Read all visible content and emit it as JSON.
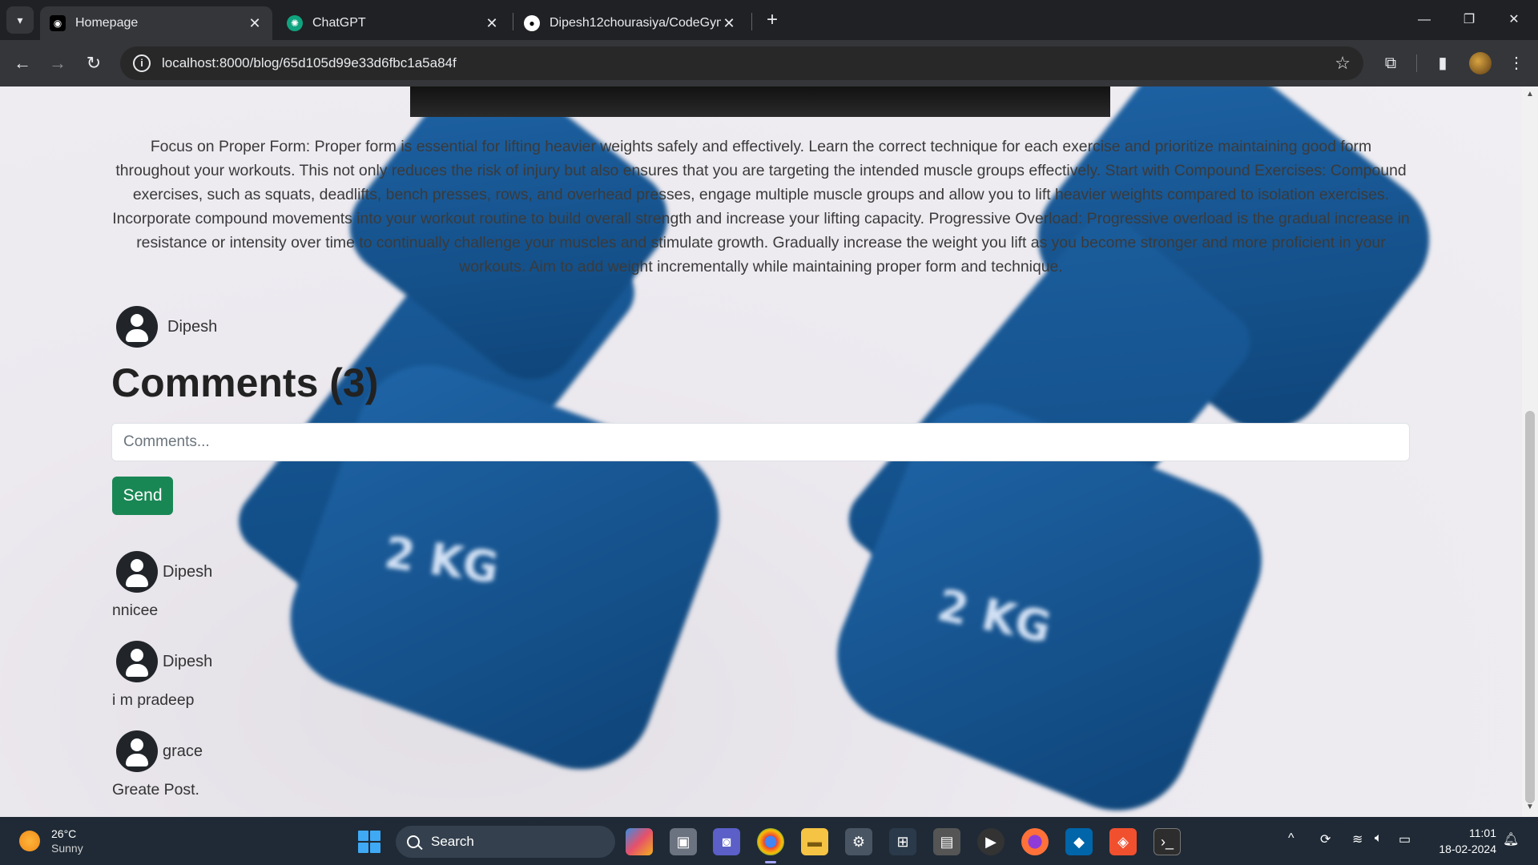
{
  "browser": {
    "tabs": [
      {
        "title": "Homepage",
        "active": true
      },
      {
        "title": "ChatGPT",
        "active": false
      },
      {
        "title": "Dipesh12chourasiya/CodeGym",
        "active": false
      }
    ],
    "url": "localhost:8000/blog/65d105d99e33d6fbc1a5a84f"
  },
  "post": {
    "body": "Focus on Proper Form: Proper form is essential for lifting heavier weights safely and effectively. Learn the correct technique for each exercise and prioritize maintaining good form throughout your workouts. This not only reduces the risk of injury but also ensures that you are targeting the intended muscle groups effectively. Start with Compound Exercises: Compound exercises, such as squats, deadlifts, bench presses, rows, and overhead presses, engage multiple muscle groups and allow you to lift heavier weights compared to isolation exercises. Incorporate compound movements into your workout routine to build overall strength and increase your lifting capacity. Progressive Overload: Progressive overload is the gradual increase in resistance or intensity over time to continually challenge your muscles and stimulate growth. Gradually increase the weight you lift as you become stronger and more proficient in your workouts. Aim to add weight incrementally while maintaining proper form and technique.",
    "author": "Dipesh",
    "bg_text": [
      "2 KG",
      "2 KG"
    ]
  },
  "comments": {
    "title": "Comments (3)",
    "input_placeholder": "Comments...",
    "send_label": "Send",
    "items": [
      {
        "author": "Dipesh",
        "text": "nnicee"
      },
      {
        "author": "Dipesh",
        "text": "i m pradeep"
      },
      {
        "author": "grace",
        "text": "Greate Post."
      }
    ]
  },
  "taskbar": {
    "weather_temp": "26°C",
    "weather_cond": "Sunny",
    "search_label": "Search",
    "time": "11:01",
    "date": "18-02-2024"
  },
  "colors": {
    "send_button": "#198754",
    "dumbbell": "#1b5d9c",
    "chrome_dark": "#202124"
  }
}
